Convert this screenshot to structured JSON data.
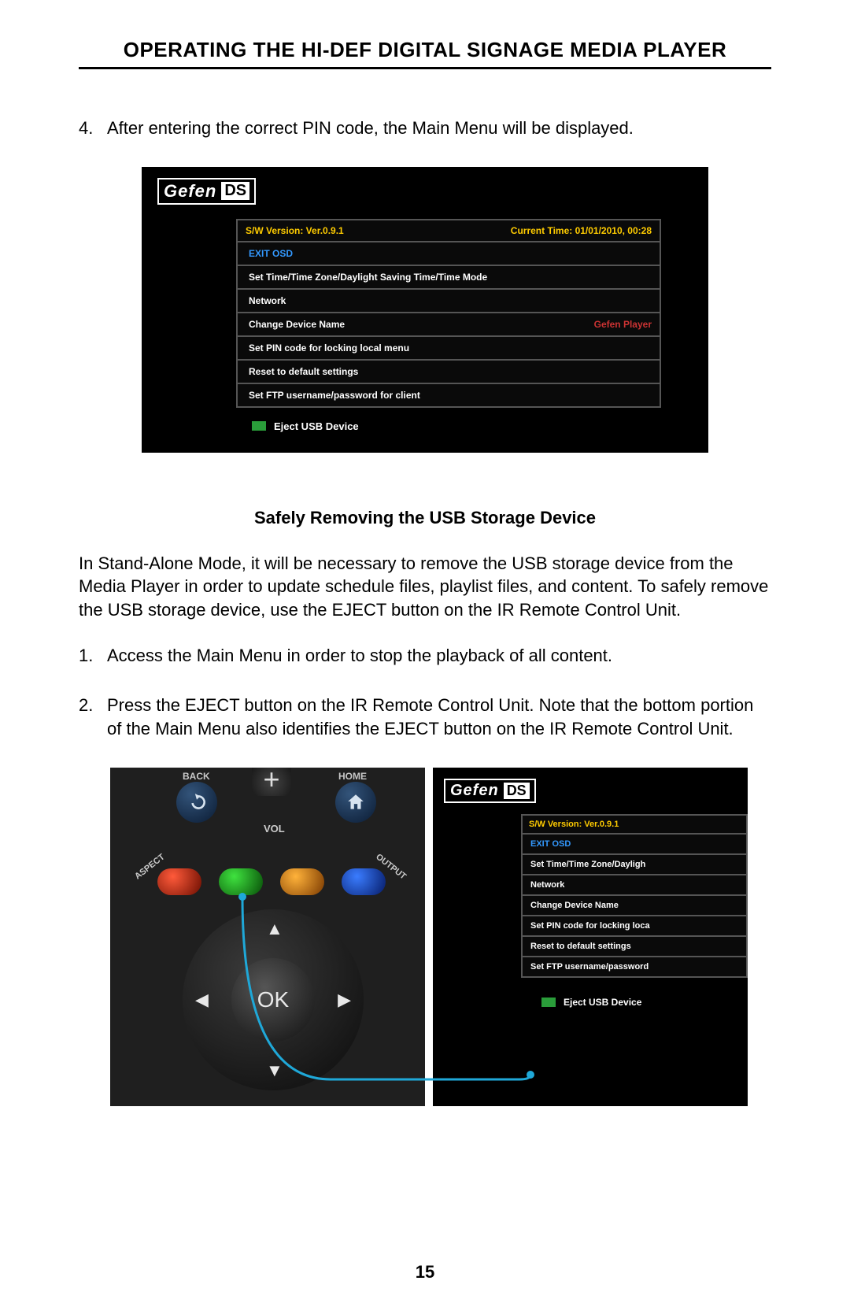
{
  "page": {
    "title": "OPERATING THE HI-DEF DIGITAL SIGNAGE MEDIA PLAYER",
    "number": "15"
  },
  "intro_step": {
    "num": "4.",
    "text": "After entering the correct PIN code, the Main Menu will be displayed."
  },
  "screenshot1": {
    "logo_brand": "Gefen",
    "logo_ds": "DS",
    "sw_version": "S/W Version: Ver.0.9.1",
    "current_time": "Current Time: 01/01/2010, 00:28",
    "rows": [
      {
        "label": "EXIT OSD",
        "selected": true
      },
      {
        "label": "Set Time/Time Zone/Daylight Saving Time/Time Mode"
      },
      {
        "label": "Network"
      },
      {
        "label": "Change Device Name",
        "right": "Gefen Player"
      },
      {
        "label": "Set PIN code for locking local menu"
      },
      {
        "label": "Reset to default settings"
      },
      {
        "label": "Set FTP username/password for client"
      }
    ],
    "eject_label": "Eject USB Device"
  },
  "section_heading": "Safely Removing the USB Storage Device",
  "para1": "In Stand-Alone Mode, it will be necessary to remove the USB storage device from the Media Player in order to update schedule files, playlist files, and content.  To safely remove the USB storage device, use the EJECT button on the IR Remote Control Unit.",
  "step1": {
    "num": "1.",
    "text": "Access the Main Menu in order to stop the playback of all content."
  },
  "step2": {
    "num": "2.",
    "text": "Press the EJECT button on the IR Remote Control Unit.  Note that the bottom portion of the Main Menu also identifies the EJECT button on the IR Remote Control Unit."
  },
  "remote": {
    "back": "BACK",
    "home": "HOME",
    "vol": "VOL",
    "aspect": "ASPECT",
    "output": "OUTPUT",
    "ok": "OK"
  },
  "screenshot2": {
    "logo_brand": "Gefen",
    "logo_ds": "DS",
    "sw_version": "S/W Version: Ver.0.9.1",
    "rows": [
      {
        "label": "EXIT OSD",
        "selected": true
      },
      {
        "label": "Set Time/Time Zone/Dayligh"
      },
      {
        "label": "Network"
      },
      {
        "label": "Change Device Name"
      },
      {
        "label": "Set PIN code for locking loca"
      },
      {
        "label": "Reset to default settings"
      },
      {
        "label": "Set FTP username/password"
      }
    ],
    "eject_label": "Eject USB Device"
  }
}
